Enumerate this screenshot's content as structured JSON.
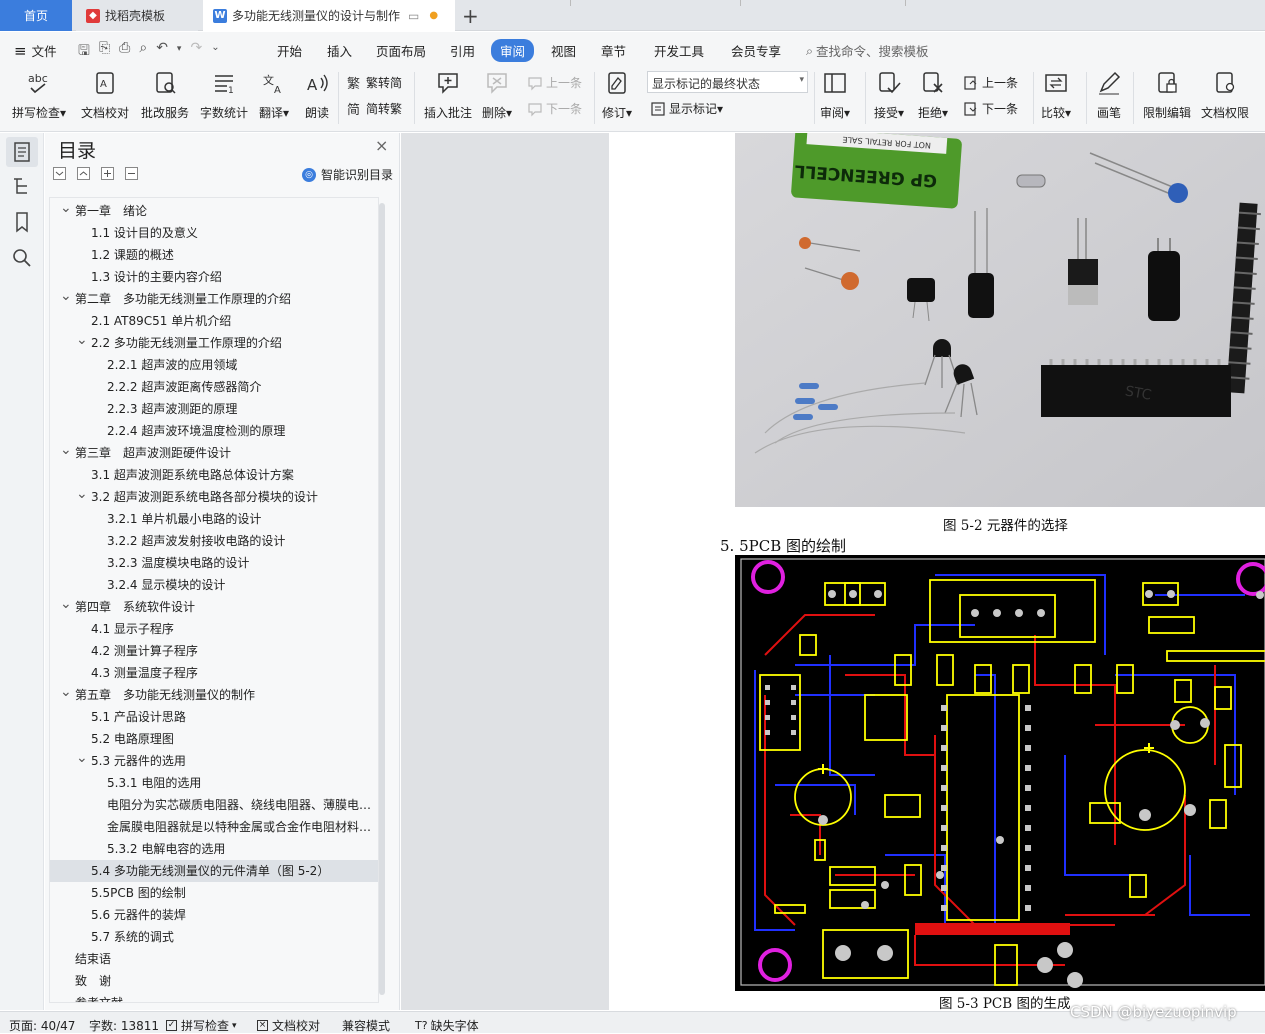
{
  "tabs": {
    "home": "首页",
    "template": "找稻壳模板",
    "document": "多功能无线测量仪的设计与制作",
    "new_tab": "+"
  },
  "menu": {
    "file": "文件",
    "items": [
      "开始",
      "插入",
      "页面布局",
      "引用",
      "审阅",
      "视图",
      "章节",
      "开发工具",
      "会员专享"
    ],
    "active": "审阅",
    "search_placeholder": "查找命令、搜索模板"
  },
  "ribbon": {
    "spell_check": "拼写检查",
    "doc_proof": "文档校对",
    "batch_service": "批改服务",
    "word_count": "字数统计",
    "translate": "翻译",
    "read_aloud": "朗读",
    "to_traditional": "繁转简",
    "to_simplified": "简转繁",
    "insert_comment": "插入批注",
    "delete": "删除",
    "prev": "上一条",
    "next": "下一条",
    "revise": "修订",
    "show_markup_state": "显示标记的最终状态",
    "show_markup": "显示标记",
    "review": "审阅",
    "accept": "接受",
    "reject": "拒绝",
    "prev2": "上一条",
    "next2": "下一条",
    "compare": "比较",
    "draw": "画笔",
    "restrict_edit": "限制编辑",
    "doc_permission": "文档权限"
  },
  "toc": {
    "title": "目录",
    "smart": "智能识别目录",
    "items": [
      {
        "level": 1,
        "text": "第一章　绪论",
        "caret": "open"
      },
      {
        "level": 2,
        "text": "1.1 设计目的及意义"
      },
      {
        "level": 2,
        "text": "1.2 课题的概述"
      },
      {
        "level": 2,
        "text": "1.3 设计的主要内容介绍"
      },
      {
        "level": 1,
        "text": "第二章　多功能无线测量工作原理的介绍",
        "caret": "open"
      },
      {
        "level": 2,
        "text": "2.1 AT89C51 单片机介绍"
      },
      {
        "level": 2,
        "text": "2.2  多功能无线测量工作原理的介绍",
        "caret": "open"
      },
      {
        "level": 3,
        "text": "2.2.1 超声波的应用领域"
      },
      {
        "level": 3,
        "text": "2.2.2  超声波距离传感器简介"
      },
      {
        "level": 3,
        "text": "2.2.3 超声波测距的原理"
      },
      {
        "level": 3,
        "text": "2.2.4 超声波环境温度检测的原理"
      },
      {
        "level": 1,
        "text": "第三章　超声波测距硬件设计",
        "caret": "open"
      },
      {
        "level": 2,
        "text": "3.1 超声波测距系统电路总体设计方案"
      },
      {
        "level": 2,
        "text": "3.2  超声波测距系统电路各部分模块的设计",
        "caret": "open"
      },
      {
        "level": 3,
        "text": "3.2.1 单片机最小电路的设计"
      },
      {
        "level": 3,
        "text": "3.2.2 超声波发射接收电路的设计"
      },
      {
        "level": 3,
        "text": "3.2.3 温度模块电路的设计"
      },
      {
        "level": 3,
        "text": "3.2.4 显示模块的设计"
      },
      {
        "level": 1,
        "text": "第四章　系统软件设计",
        "caret": "open"
      },
      {
        "level": 2,
        "text": "4.1  显示子程序"
      },
      {
        "level": 2,
        "text": "4.2 测量计算子程序"
      },
      {
        "level": 2,
        "text": "4.3 测量温度子程序"
      },
      {
        "level": 1,
        "text": "第五章　多功能无线测量仪的制作",
        "caret": "open"
      },
      {
        "level": 2,
        "text": "5.1 产品设计思路"
      },
      {
        "level": 2,
        "text": "5.2  电路原理图"
      },
      {
        "level": 2,
        "text": "5.3 元器件的选用",
        "caret": "open"
      },
      {
        "level": 3,
        "text": "5.3.1 电阻的选用"
      },
      {
        "level": 3,
        "text": "电阻分为实芯碳质电阻器、绕线电阻器、薄膜电阻器..."
      },
      {
        "level": 3,
        "text": "金属膜电阻器就是以特种金属或合金作电阻材料，..."
      },
      {
        "level": 3,
        "text": "5.3.2 电解电容的选用"
      },
      {
        "level": 2,
        "text": "5.4  多功能无线测量仪的元件清单（图 5-2）",
        "selected": true
      },
      {
        "level": 2,
        "text": "5.5PCB 图的绘制"
      },
      {
        "level": 2,
        "text": "5.6 元器件的装焊"
      },
      {
        "level": 2,
        "text": "5.7 系统的调式"
      },
      {
        "level": 1,
        "text": "结束语"
      },
      {
        "level": 1,
        "text": "致　谢"
      },
      {
        "level": 1,
        "text": "参考文献"
      }
    ]
  },
  "document": {
    "fig2_caption": "图 5-2  元器件的选择",
    "section_heading": "5. 5PCB 图的绘制",
    "fig3_caption": "图 5-3    PCB 图的生成",
    "battery_brand": "GP GREENCELL",
    "battery_text": "NOT FOR RETAIL SALE",
    "chip_text": "STC"
  },
  "status": {
    "page": "页面: 40/47",
    "words": "字数: 13811",
    "spell": "拼写检查",
    "proof": "文档校对",
    "compat": "兼容模式",
    "missing_font": "缺失字体"
  },
  "watermark": "CSDN @biyezuopinvip",
  "colors": {
    "accent": "#3b7ddd",
    "pcb_bg": "#000000",
    "pcb_yellow": "#ffff00",
    "pcb_red": "#e01010",
    "pcb_blue": "#2030ff",
    "pcb_magenta": "#e020e0"
  }
}
